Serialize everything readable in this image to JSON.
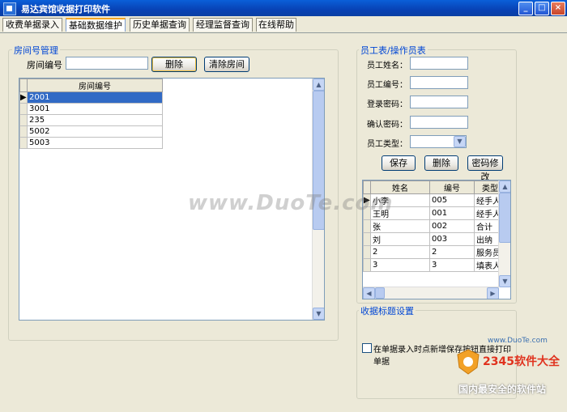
{
  "window": {
    "title": "易达宾馆收据打印软件",
    "min": "_",
    "max": "□",
    "close": "×"
  },
  "tabs": [
    "收费单据录入",
    "基础数据维护",
    "历史单据查询",
    "经理监督查询",
    "在线帮助"
  ],
  "room_group": {
    "title": "房间号管理",
    "room_no_label": "房间编号",
    "room_no_value": "",
    "delete_label": "删除",
    "clear_label": "清除房间",
    "column": "房间编号",
    "rows": [
      "2001",
      "3001",
      "235",
      "5002",
      "5003"
    ]
  },
  "staff_group": {
    "title": "员工表/操作员表",
    "name_label": "员工姓名：",
    "id_label": "员工编号：",
    "pwd_label": "登录密码：",
    "confirm_label": "确认密码：",
    "type_label": "员工类型：",
    "save_label": "保存",
    "delete_label": "删除",
    "change_pwd_label": "密码修改",
    "columns": [
      "姓名",
      "编号",
      "类型"
    ],
    "rows": [
      [
        "小李",
        "005",
        "经手人"
      ],
      [
        "王明",
        "001",
        "经手人"
      ],
      [
        "张",
        "002",
        "合计"
      ],
      [
        "刘",
        "003",
        "出纳"
      ],
      [
        "2",
        "2",
        "服务员"
      ],
      [
        "3",
        "3",
        "填表人"
      ]
    ]
  },
  "receipt_group": {
    "title": "收据标题设置",
    "checkbox_label": "在单据录入时点新增保存按钮直接打印单据"
  },
  "watermark": {
    "duote": "www.DuoTe.com",
    "site1": "www.DuoTe.com",
    "brand": "2345软件大全",
    "slogan": "国内最安全的软件站"
  }
}
